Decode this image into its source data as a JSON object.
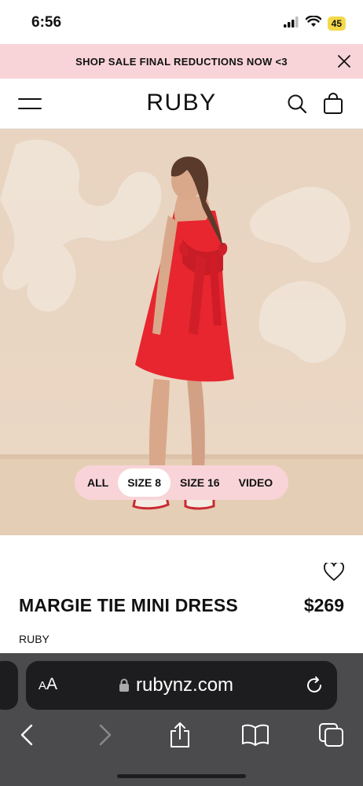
{
  "status_bar": {
    "time": "6:56",
    "battery": "45"
  },
  "promo": {
    "text": "SHOP SALE FINAL REDUCTIONS NOW <3"
  },
  "header": {
    "logo": "RUBY"
  },
  "gallery": {
    "filters": [
      {
        "label": "ALL",
        "active": false
      },
      {
        "label": "SIZE 8",
        "active": true
      },
      {
        "label": "SIZE 16",
        "active": false
      },
      {
        "label": "VIDEO",
        "active": false
      }
    ]
  },
  "product": {
    "name": "MARGIE TIE MINI DRESS",
    "price": "$269",
    "brand": "RUBY",
    "dress_color": "#e8262f"
  },
  "browser": {
    "aa_small": "A",
    "aa_large": "A",
    "url": "rubynz.com"
  }
}
